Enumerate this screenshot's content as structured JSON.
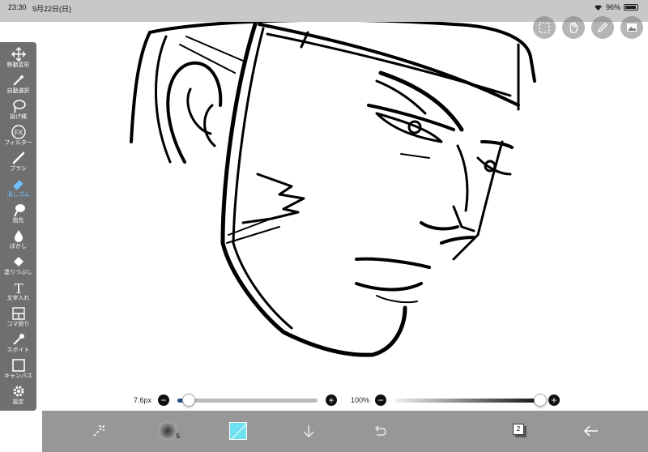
{
  "status": {
    "time": "23:30",
    "date": "9月22日(日)",
    "battery": "96%"
  },
  "sidebar": {
    "items": [
      {
        "label": "移動変形",
        "icon": "move-arrows-icon"
      },
      {
        "label": "自動選択",
        "icon": "magic-wand-icon"
      },
      {
        "label": "投げ縄",
        "icon": "lasso-icon"
      },
      {
        "label": "フィルター",
        "icon": "fx-icon",
        "icon_text": "FX"
      },
      {
        "label": "ブラシ",
        "icon": "brush-icon"
      },
      {
        "label": "消しゴム",
        "icon": "eraser-icon",
        "active": true
      },
      {
        "label": "指先",
        "icon": "finger-icon"
      },
      {
        "label": "ぼかし",
        "icon": "blur-drop-icon"
      },
      {
        "label": "塗りつぶし",
        "icon": "fill-bucket-icon"
      },
      {
        "label": "文字入れ",
        "icon": "text-icon",
        "icon_text": "T"
      },
      {
        "label": "コマ割り",
        "icon": "frame-divide-icon"
      },
      {
        "label": "スポイト",
        "icon": "eyedropper-icon"
      },
      {
        "label": "キャンバス",
        "icon": "canvas-icon"
      },
      {
        "label": "設定",
        "icon": "gear-icon"
      }
    ]
  },
  "brush_size": {
    "label": "7.6px",
    "minus": "−",
    "plus": "+",
    "value_fraction": 0.08
  },
  "opacity": {
    "label": "100%",
    "minus": "−",
    "plus": "+",
    "value_fraction": 1.0
  },
  "bottom": {
    "brush_badge": "5",
    "layers_count": "2"
  },
  "colors": {
    "accent": "#6fc0ff",
    "current_color": "#6fe0f0"
  }
}
